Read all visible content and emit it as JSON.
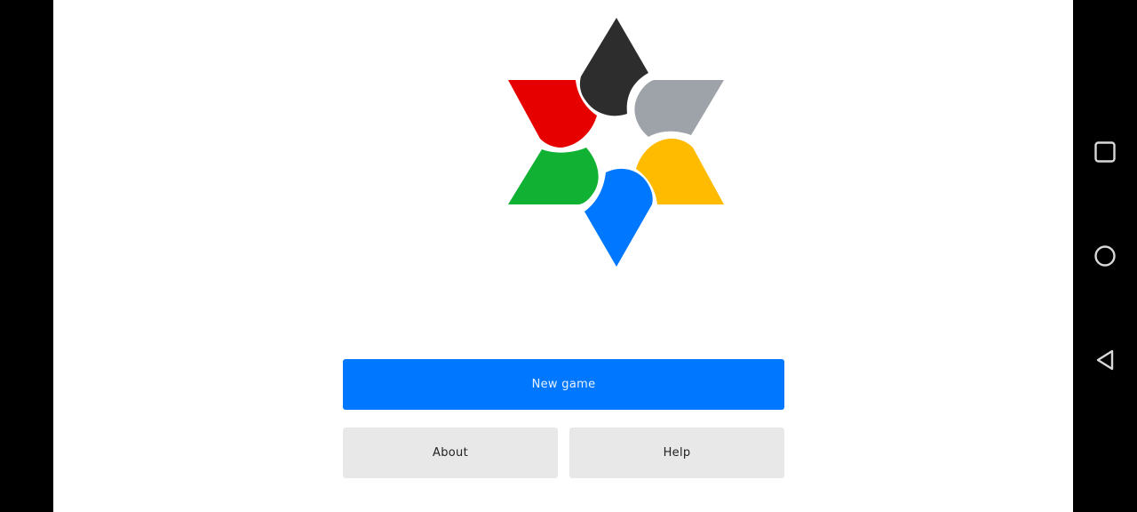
{
  "app": {
    "logo_icon": "six-color-star-logo-icon",
    "logo_colors": {
      "black": "#2d2d2d",
      "gray": "#9ea3a9",
      "yellow": "#ffbb00",
      "blue": "#0077ff",
      "green": "#11b233",
      "red": "#e60000"
    }
  },
  "menu": {
    "new_game_label": "New game",
    "about_label": "About",
    "help_label": "Help",
    "primary_color": "#0077ff",
    "secondary_color": "#e8e8e8"
  },
  "navigation_bar": {
    "recents_icon": "square-icon",
    "home_icon": "circle-icon",
    "back_icon": "triangle-back-icon"
  }
}
